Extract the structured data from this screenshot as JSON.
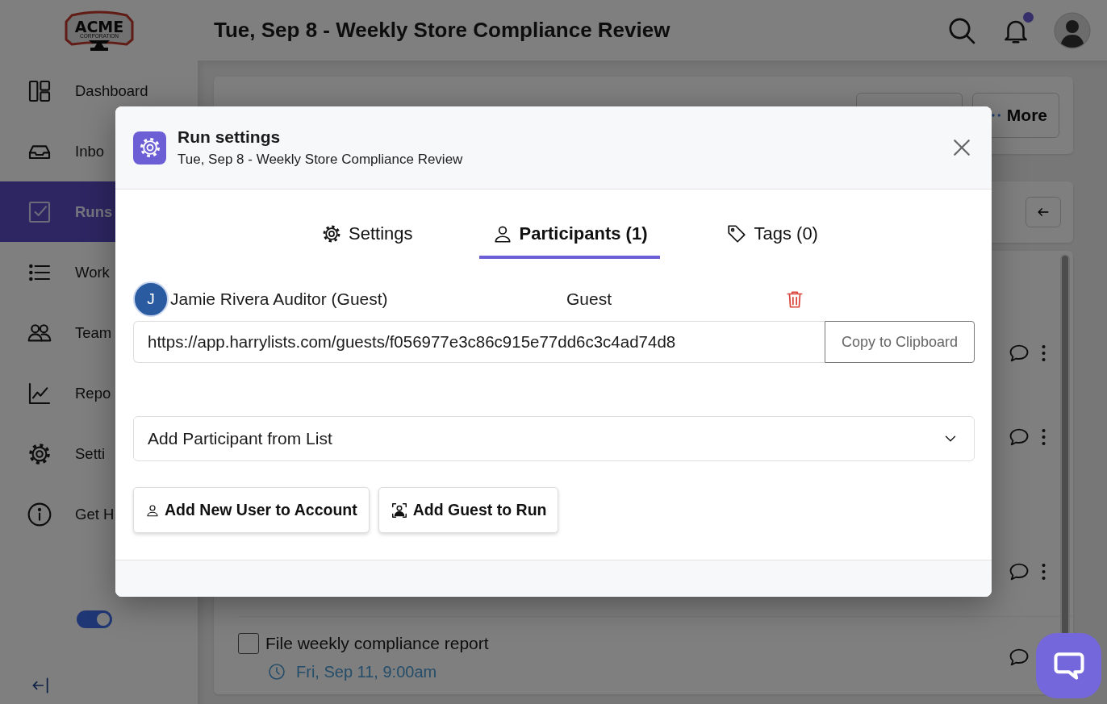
{
  "logo": {
    "name": "ACME",
    "tagline": "CORPORATION"
  },
  "header": {
    "title": "Tue, Sep 8 - Weekly Store Compliance Review",
    "notifications_unread": true
  },
  "sidebar": {
    "items": [
      {
        "label": "Dashboard",
        "selected": false
      },
      {
        "label": "Inbo",
        "selected": false
      },
      {
        "label": "Runs",
        "selected": true
      },
      {
        "label": "Work",
        "selected": false
      },
      {
        "label": "Team",
        "selected": false
      },
      {
        "label": "Repo",
        "selected": false
      },
      {
        "label": "Setti",
        "selected": false
      },
      {
        "label": "Get H",
        "selected": false
      }
    ],
    "toggle": {
      "on": true
    }
  },
  "toolbar": {
    "more_label": "More"
  },
  "tasks": [
    {
      "kind": "covered"
    },
    {
      "kind": "covered"
    },
    {
      "kind": "covered"
    },
    {
      "kind": "task",
      "title": "File weekly compliance report",
      "due": "Fri, Sep 11, 9:00am",
      "checked": false
    }
  ],
  "modal": {
    "title": "Run settings",
    "subtitle": "Tue, Sep 8 - Weekly Store Compliance Review",
    "tabs": [
      {
        "label": "Settings",
        "selected": false
      },
      {
        "label": "Participants (1)",
        "selected": true
      },
      {
        "label": "Tags (0)",
        "selected": false
      }
    ],
    "participants": [
      {
        "initial": "J",
        "name": "Jamie Rivera Auditor (Guest)",
        "role": "Guest",
        "link": "https://app.harrylists.com/guests/f056977e3c86c915e77dd6c3c4ad74d8",
        "copy_label": "Copy to Clipboard"
      }
    ],
    "add_select": {
      "placeholder": "Add Participant from List"
    },
    "buttons": [
      {
        "label": "Add New User to Account"
      },
      {
        "label": "Add Guest to Run"
      }
    ]
  }
}
